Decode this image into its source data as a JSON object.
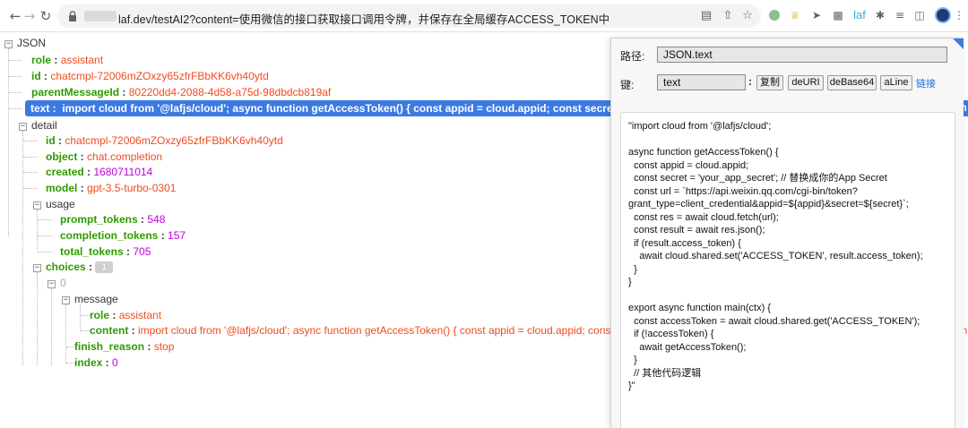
{
  "browser": {
    "url_path": "laf.dev/testAI2?content=使用微信的接口获取接口调用令牌，并保存在全局缓存ACCESS_TOKEN中",
    "extension_text": "laf"
  },
  "tree": {
    "root_label": "JSON",
    "role_key": "role",
    "role_value": "assistant",
    "id_key": "id",
    "id_value": "chatcmpl-72006mZOxzy65zfrFBbKK6vh40ytd",
    "parent_key": "parentMessageId",
    "parent_value": "80220dd4-2088-4d58-a75d-98dbdcb819af",
    "text_key": "text",
    "text_value": "import cloud from '@lafjs/cloud'; async function getAccessToken() { const appid = cloud.appid; const secret = 'your",
    "detail_label": "detail",
    "detail_id_key": "id",
    "detail_id_value": "chatcmpl-72006mZOxzy65zfrFBbKK6vh40ytd",
    "object_key": "object",
    "object_value": "chat.completion",
    "created_key": "created",
    "created_value": "1680711014",
    "model_key": "model",
    "model_value": "gpt-3.5-turbo-0301",
    "usage_label": "usage",
    "prompt_key": "prompt_tokens",
    "prompt_value": "548",
    "completion_key": "completion_tokens",
    "completion_value": "157",
    "total_key": "total_tokens",
    "total_value": "705",
    "choices_key": "choices",
    "choices_count": "1",
    "index_label": "0",
    "message_label": "message",
    "msg_role_key": "role",
    "msg_role_value": "assistant",
    "content_key": "content",
    "content_value": "import cloud from '@lafjs/cloud'; async function getAccessToken() { const appid = cloud.appid; const secret = 'your",
    "finish_key": "finish_reason",
    "finish_value": "stop",
    "idx_key": "index",
    "idx_value": "0",
    "row_overflow_tail": "in"
  },
  "panel": {
    "path_label": "路径:",
    "path_value": "JSON.text",
    "key_label": "键:",
    "key_value": "text",
    "colon": ":",
    "buttons": [
      "复制",
      "deURI",
      "deBase64",
      "aLine"
    ],
    "link": "链接",
    "code": "\"import cloud from '@lafjs/cloud';\n\nasync function getAccessToken() {\n  const appid = cloud.appid;\n  const secret = 'your_app_secret'; // 替换成你的App Secret\n  const url = `https://api.weixin.qq.com/cgi-bin/token?\ngrant_type=client_credential&appid=${appid}&secret=${secret}`;\n  const res = await cloud.fetch(url);\n  const result = await res.json();\n  if (result.access_token) {\n    await cloud.shared.set('ACCESS_TOKEN', result.access_token);\n  }\n}\n\nexport async function main(ctx) {\n  const accessToken = await cloud.shared.get('ACCESS_TOKEN');\n  if (!accessToken) {\n    await getAccessToken();\n  }\n  // 其他代码逻辑\n}\""
  }
}
